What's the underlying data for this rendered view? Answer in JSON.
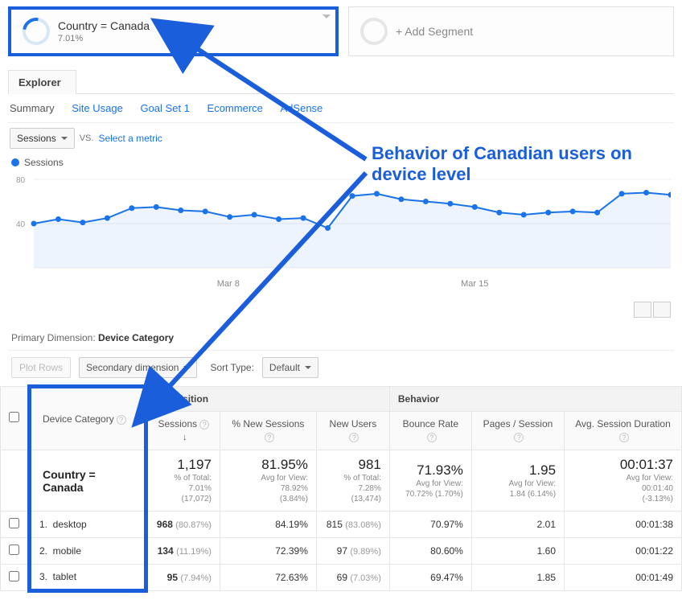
{
  "segments": {
    "active": {
      "title": "Country = Canada",
      "sub": "7.01%"
    },
    "add_label": "+ Add Segment"
  },
  "tabs": {
    "explorer": "Explorer"
  },
  "subtabs": [
    "Summary",
    "Site Usage",
    "Goal Set 1",
    "Ecommerce",
    "AdSense"
  ],
  "selectors": {
    "metric": "Sessions",
    "vs": "VS.",
    "select_metric": "Select a metric"
  },
  "legend": "Sessions",
  "annotation": "Behavior of Canadian users on device level",
  "chart_data": {
    "type": "line",
    "title": "",
    "xlabel": "",
    "ylabel": "",
    "ylim": [
      0,
      80
    ],
    "y_ticks": [
      40,
      80
    ],
    "x_ticks": [
      "Mar 8",
      "Mar 15"
    ],
    "series": [
      {
        "name": "Sessions",
        "values": [
          40,
          44,
          41,
          45,
          54,
          55,
          52,
          51,
          46,
          48,
          44,
          45,
          36,
          65,
          67,
          62,
          60,
          58,
          55,
          50,
          48,
          50,
          51,
          50,
          67,
          68,
          66
        ]
      }
    ]
  },
  "primary_dimension": {
    "label": "Primary Dimension:",
    "value": "Device Category"
  },
  "table_controls": {
    "plot_rows": "Plot Rows",
    "secondary_dimension": "Secondary dimension",
    "sort_type_label": "Sort Type:",
    "sort_type_value": "Default"
  },
  "table": {
    "groups": {
      "acquisition": "Acquisition",
      "behavior": "Behavior"
    },
    "dim_header": "Device Category",
    "columns": [
      "Sessions",
      "% New Sessions",
      "New Users",
      "Bounce Rate",
      "Pages / Session",
      "Avg. Session Duration"
    ],
    "summary": {
      "label": "Country = Canada",
      "cells": [
        {
          "big": "1,197",
          "l1": "% of Total:",
          "l2": "7.01%",
          "l3": "(17,072)"
        },
        {
          "big": "81.95%",
          "l1": "Avg for View:",
          "l2": "78.92%",
          "l3": "(3.84%)"
        },
        {
          "big": "981",
          "l1": "% of Total:",
          "l2": "7.28%",
          "l3": "(13,474)"
        },
        {
          "big": "71.93%",
          "l1": "Avg for View:",
          "l2": "70.72% (1.70%)",
          "l3": ""
        },
        {
          "big": "1.95",
          "l1": "Avg for View:",
          "l2": "1.84 (6.14%)",
          "l3": ""
        },
        {
          "big": "00:01:37",
          "l1": "Avg for View:",
          "l2": "00:01:40",
          "l3": "(-3.13%)"
        }
      ]
    },
    "rows": [
      {
        "idx": "1.",
        "dim": "desktop",
        "sessions_v": "968",
        "sessions_p": "(80.87%)",
        "pnew": "84.19%",
        "newu_v": "815",
        "newu_p": "(83.08%)",
        "bounce": "70.97%",
        "pps": "2.01",
        "dur": "00:01:38"
      },
      {
        "idx": "2.",
        "dim": "mobile",
        "sessions_v": "134",
        "sessions_p": "(11.19%)",
        "pnew": "72.39%",
        "newu_v": "97",
        "newu_p": "(9.89%)",
        "bounce": "80.60%",
        "pps": "1.60",
        "dur": "00:01:22"
      },
      {
        "idx": "3.",
        "dim": "tablet",
        "sessions_v": "95",
        "sessions_p": "(7.94%)",
        "pnew": "72.63%",
        "newu_v": "69",
        "newu_p": "(7.03%)",
        "bounce": "69.47%",
        "pps": "1.85",
        "dur": "00:01:49"
      }
    ]
  }
}
